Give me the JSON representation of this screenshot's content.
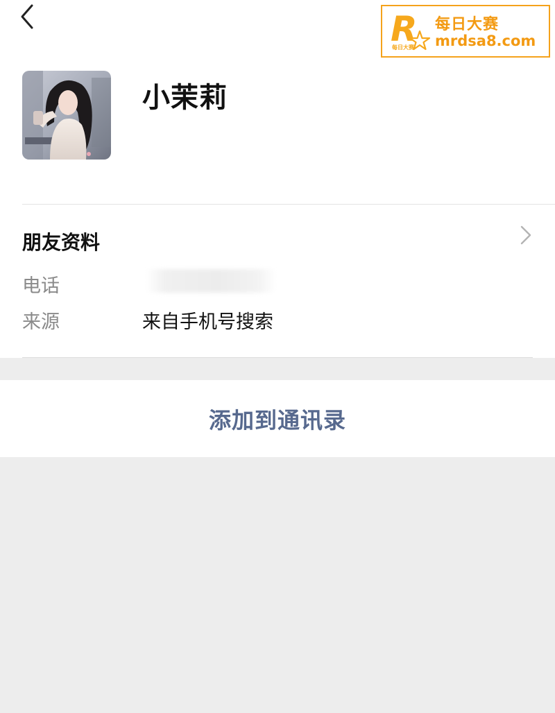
{
  "profile": {
    "name": "小茉莉"
  },
  "watermark": {
    "cn_text": "每日大赛",
    "url": "mrdsa8.com",
    "logo_letter": "R",
    "logo_small_text": "每日大赛"
  },
  "section": {
    "title": "朋友资料"
  },
  "fields": {
    "phone_label": "电话",
    "source_label": "来源",
    "source_value": "来自手机号搜索"
  },
  "actions": {
    "add_contact": "添加到通讯录"
  },
  "colors": {
    "page_bg": "#ededed",
    "card_bg": "#ffffff",
    "action_text": "#57698e",
    "watermark_accent": "#f39a12"
  },
  "icons": {
    "back": "chevron-left-icon",
    "more": "chevron-right-icon"
  }
}
